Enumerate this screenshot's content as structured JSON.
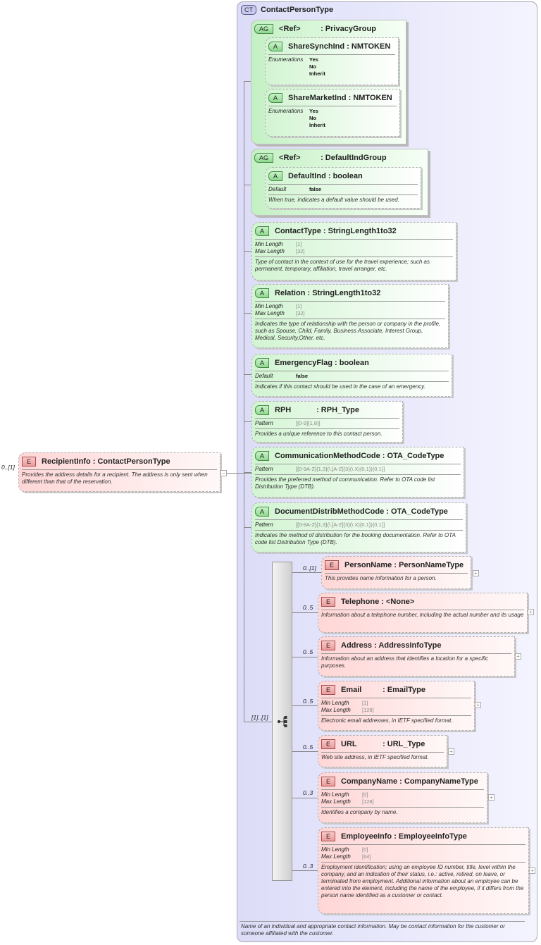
{
  "complex_type": {
    "badge": "CT",
    "name": "ContactPersonType",
    "documentation": "Name of an individual and appropriate contact information.  May be contact information for the customer or someone affiliated with the customer."
  },
  "root_element": {
    "badge": "E",
    "name": "RecipientInfo",
    "type": "ContactPersonType",
    "cardinality": "0..[1]",
    "documentation": "Provides the address details for a recipient. The address is only sent when different than that of the reservation."
  },
  "sequence": {
    "cardinality": "[1]..[1]"
  },
  "boxes": [
    {
      "kind": "ag",
      "badge": "AG",
      "name": "<Ref>",
      "type": "PrivacyGroup"
    },
    {
      "kind": "attr",
      "badge": "A",
      "name": "ShareSynchInd",
      "type": "NMTOKEN",
      "facets": [
        {
          "label": "Enumerations",
          "values": [
            "Yes",
            "No",
            "Inherit"
          ]
        }
      ]
    },
    {
      "kind": "attr",
      "badge": "A",
      "name": "ShareMarketInd",
      "type": "NMTOKEN",
      "facets": [
        {
          "label": "Enumerations",
          "values": [
            "Yes",
            "No",
            "Inherit"
          ]
        }
      ]
    },
    {
      "kind": "ag",
      "badge": "AG",
      "name": "<Ref>",
      "type": "DefaultIndGroup"
    },
    {
      "kind": "attr",
      "badge": "A",
      "name": "DefaultInd",
      "type": "boolean",
      "facets": [
        {
          "label": "Default",
          "value": "false",
          "dark": true
        }
      ],
      "documentation": "When true, indicates a default value should be used."
    },
    {
      "kind": "attr",
      "badge": "A",
      "name": "ContactType",
      "type": "StringLength1to32",
      "facets": [
        {
          "label": "Min Length",
          "value": "[1]"
        },
        {
          "label": "Max Length",
          "value": "[32]"
        }
      ],
      "documentation": "Type of contact in the context of use for the travel experience; such as permanent, temporary, affiliation, travel arranger, etc."
    },
    {
      "kind": "attr",
      "badge": "A",
      "name": "Relation",
      "type": "StringLength1to32",
      "facets": [
        {
          "label": "Min Length",
          "value": "[1]"
        },
        {
          "label": "Max Length",
          "value": "[32]"
        }
      ],
      "documentation": "Indicates the type of relationship with the person or company in the profile, such as Spouse, Child, Family, Business Associate, Interest Group, Medical, Security,Other, etc."
    },
    {
      "kind": "attr",
      "badge": "A",
      "name": "EmergencyFlag",
      "type": "boolean",
      "facets": [
        {
          "label": "Default",
          "value": "false",
          "dark": true
        }
      ],
      "documentation": "Indicates if this contact should be used in the case of an emergency."
    },
    {
      "kind": "attr",
      "badge": "A",
      "name": "RPH",
      "type": "RPH_Type",
      "facets": [
        {
          "label": "Pattern",
          "value": "[[0-9]{1,8}]"
        }
      ],
      "documentation": "Provides a unique reference to this contact person."
    },
    {
      "kind": "attr",
      "badge": "A",
      "name": "CommunicationMethodCode",
      "type": "OTA_CodeType",
      "facets": [
        {
          "label": "Pattern",
          "value": "[[0-9A-Z]{1,3}(\\.[A-Z]{3}(\\.X){0,1}){0,1}]"
        }
      ],
      "documentation": "Provides the preferred method of communication.  Refer to OTA code list Distribution Type (DTB)."
    },
    {
      "kind": "attr",
      "badge": "A",
      "name": "DocumentDistribMethodCode",
      "type": "OTA_CodeType",
      "facets": [
        {
          "label": "Pattern",
          "value": "[[0-9A-Z]{1,3}(\\.[A-Z]{3}(\\.X){0,1}){0,1}]"
        }
      ],
      "documentation": "Indicates the method of distribution for the booking documentation.  Refer to OTA code list Distribution Type (DTB)."
    },
    {
      "kind": "elem",
      "badge": "E",
      "name": "PersonName",
      "type": "PersonNameType",
      "cardinality": "0..[1]",
      "documentation": "This provides name information for a person."
    },
    {
      "kind": "elem",
      "badge": "E",
      "name": "Telephone",
      "type": "<None>",
      "cardinality": "0..5",
      "documentation": "Information about a telephone number, including the actual number and its usage"
    },
    {
      "kind": "elem",
      "badge": "E",
      "name": "Address",
      "type": "AddressInfoType",
      "cardinality": "0..5",
      "documentation": "Information about an address that identifies a location for a specific purposes."
    },
    {
      "kind": "elem",
      "badge": "E",
      "name": "Email",
      "type": "EmailType",
      "cardinality": "0..5",
      "facets": [
        {
          "label": "Min Length",
          "value": "[1]"
        },
        {
          "label": "Max Length",
          "value": "[128]"
        }
      ],
      "documentation": "Electronic email addresses, in IETF specified format."
    },
    {
      "kind": "elem",
      "badge": "E",
      "name": "URL",
      "type": "URL_Type",
      "cardinality": "0..5",
      "documentation": "Web site address, in IETF specified format."
    },
    {
      "kind": "elem",
      "badge": "E",
      "name": "CompanyName",
      "type": "CompanyNameType",
      "cardinality": "0..3",
      "facets": [
        {
          "label": "Min Length",
          "value": "[0]"
        },
        {
          "label": "Max Length",
          "value": "[128]"
        }
      ],
      "documentation": "Identifies a company by name."
    },
    {
      "kind": "elem",
      "badge": "E",
      "name": "EmployeeInfo",
      "type": "EmployeeInfoType",
      "cardinality": "0..3",
      "facets": [
        {
          "label": "Min Length",
          "value": "[0]"
        },
        {
          "label": "Max Length",
          "value": "[64]"
        }
      ],
      "documentation": "Employment identification; using an employee ID number, title, level within the company, and an indication of their status, i.e.: active, retired, on leave, or terminated from employment.  Additional information about an employee can be entered into the element, including the name of the employee, if it differs from the person name identified as a customer or contact."
    }
  ]
}
